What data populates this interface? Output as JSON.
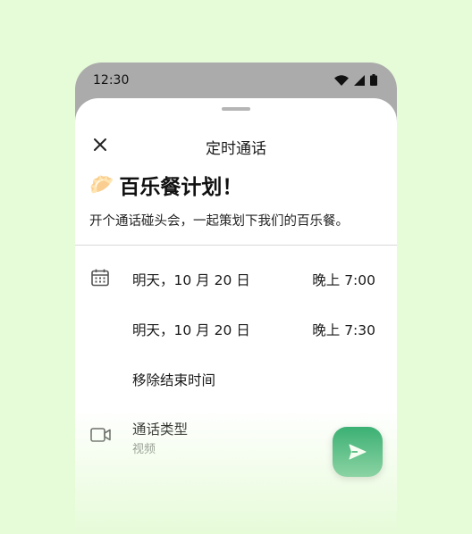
{
  "status_bar": {
    "time": "12:30"
  },
  "sheet": {
    "title": "定时通话",
    "headline_emoji": "🥟",
    "headline": "百乐餐计划！",
    "description": "开个通话碰头会，一起策划下我们的百乐餐。"
  },
  "schedule": {
    "start_date": "明天，10 月 20 日",
    "start_time": "晚上 7:00",
    "end_date": "明天，10 月 20 日",
    "end_time": "晚上 7:30",
    "remove_end_time": "移除结束时间"
  },
  "call_type": {
    "label": "通话类型",
    "value": "视频"
  },
  "colors": {
    "accent": "#1fa463",
    "background": "#e6fbd8",
    "status_bar": "#ababab"
  }
}
